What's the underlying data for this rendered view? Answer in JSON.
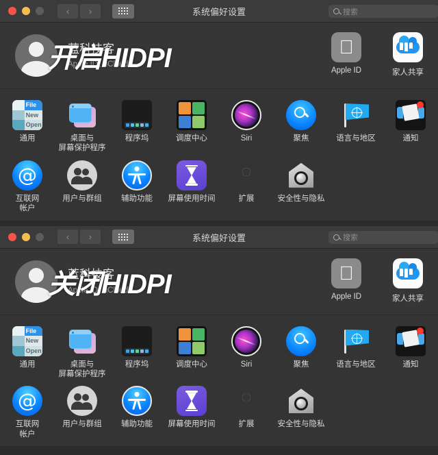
{
  "windows": [
    {
      "titlebar": {
        "title": "系统偏好设置",
        "back_glyph": "‹",
        "forward_glyph": "›",
        "grid_icon": "grid-view-icon",
        "search_placeholder": "搜索",
        "search_value": ""
      },
      "account": {
        "name": "蓝科技客",
        "subtitle": "Apple ID、iCloud",
        "overlay_text": "开启HIDPI",
        "apple_id_label": "Apple ID",
        "family_label": "家人共享"
      }
    },
    {
      "titlebar": {
        "title": "系统偏好设置",
        "back_glyph": "‹",
        "forward_glyph": "›",
        "grid_icon": "grid-view-icon",
        "search_placeholder": "搜索",
        "search_value": ""
      },
      "account": {
        "name": "蓝科技客",
        "subtitle": "Apple ID、iCloud",
        "overlay_text": "关闭HIDPI",
        "apple_id_label": "Apple ID",
        "family_label": "家人共享"
      }
    }
  ],
  "preferences": [
    {
      "id": "general",
      "label": "通用",
      "icon": "general-icon"
    },
    {
      "id": "desktop",
      "label": "桌面与\n屏幕保护程序",
      "icon": "desktop-screensaver-icon"
    },
    {
      "id": "dock",
      "label": "程序坞",
      "icon": "dock-icon"
    },
    {
      "id": "mission",
      "label": "调度中心",
      "icon": "mission-control-icon"
    },
    {
      "id": "siri",
      "label": "Siri",
      "icon": "siri-icon"
    },
    {
      "id": "spotlight",
      "label": "聚焦",
      "icon": "spotlight-icon"
    },
    {
      "id": "language",
      "label": "语言与地区",
      "icon": "language-region-icon"
    },
    {
      "id": "notifications",
      "label": "通知",
      "icon": "notifications-icon"
    },
    {
      "id": "internet",
      "label": "互联网\n帐户",
      "icon": "internet-accounts-icon"
    },
    {
      "id": "users",
      "label": "用户与群组",
      "icon": "users-groups-icon"
    },
    {
      "id": "accessibility",
      "label": "辅助功能",
      "icon": "accessibility-icon"
    },
    {
      "id": "screentime",
      "label": "屏幕使用时间",
      "icon": "screen-time-icon"
    },
    {
      "id": "extensions",
      "label": "扩展",
      "icon": "extensions-icon"
    },
    {
      "id": "security",
      "label": "安全性与隐私",
      "icon": "security-privacy-icon"
    }
  ],
  "general_icon_text": {
    "file": "File",
    "new": "New",
    "open": "Open"
  },
  "colors": {
    "window_bg": "#343434",
    "titlebar_bg": "#3b3b3b",
    "account_bg": "#363636",
    "close": "#f3554c",
    "minimize": "#f4bd4f",
    "zoom_disabled": "#5c5c5c",
    "accent_blue": "#0a84ff",
    "badge_red": "#ff3b30"
  }
}
